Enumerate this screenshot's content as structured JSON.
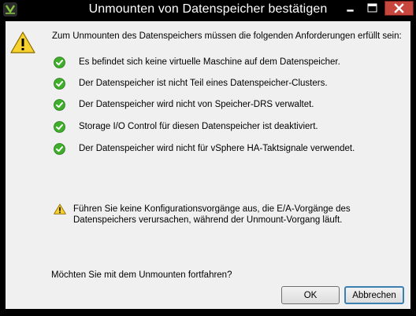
{
  "window": {
    "title": "Unmounten von Datenspeicher bestätigen"
  },
  "dialog": {
    "intro": "Zum Unmounten des Datenspeichers müssen die folgenden Anforderungen erfüllt sein:",
    "requirements": [
      "Es befindet sich keine virtuelle Maschine auf dem Datenspeicher.",
      "Der Datenspeicher ist nicht Teil eines Datenspeicher-Clusters.",
      "Der Datenspeicher wird nicht von Speicher-DRS verwaltet.",
      "Storage I/O Control für diesen Datenspeicher ist deaktiviert.",
      "Der Datenspeicher wird nicht für vSphere HA-Taktsignale verwendet."
    ],
    "warning": "Führen Sie keine Konfigurationsvorgänge aus, die E/A-Vorgänge des Datenspeichers verursachen, während der Unmount-Vorgang läuft.",
    "question": "Möchten Sie mit dem Unmounten fortfahren?",
    "ok_label": "OK",
    "cancel_label": "Abbrechen"
  },
  "icons": {
    "app": "vsphere-client-icon",
    "warning": "warning-triangle-icon",
    "check": "green-check-icon"
  },
  "colors": {
    "title_bar": "#000000",
    "close_button": "#c7463d",
    "dialog_bg": "#f0f0f0",
    "check_green": "#3fae2a",
    "warning_yellow": "#f7d12e",
    "default_button_border": "#3c7fb1"
  }
}
